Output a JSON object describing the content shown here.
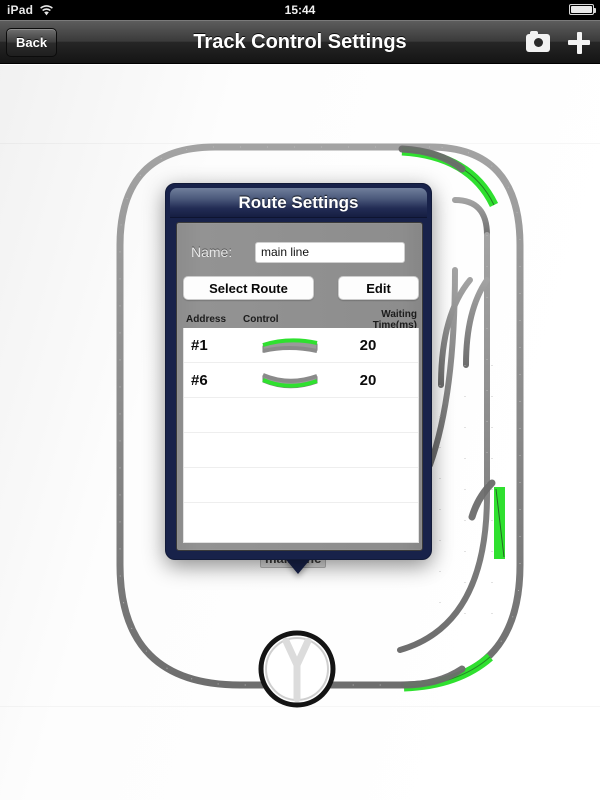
{
  "status_bar": {
    "carrier": "iPad",
    "wifi_icon": "wifi-icon",
    "clock": "15:44",
    "battery_icon": "battery-full-icon"
  },
  "nav_bar": {
    "back_label": "Back",
    "title": "Track Control Settings",
    "camera_icon": "camera-icon",
    "add_icon": "plus-icon"
  },
  "track_layout": {
    "label": "main line",
    "turntable_icon": "turntable-icon",
    "colors": {
      "rail": "#8c8c8c",
      "rail_dark": "#6f6f6f",
      "active_route": "#2fe02f",
      "background": "#ffffff"
    }
  },
  "popover": {
    "title": "Route Settings",
    "name_label": "Name:",
    "name_value": "main line",
    "name_placeholder": "Name",
    "select_route_label": "Select Route",
    "edit_label": "Edit",
    "table": {
      "columns": [
        "Address",
        "Control",
        "Waiting Time(ms)"
      ],
      "rows": [
        {
          "address": "#1",
          "control_icon": "turnout-diverging-icon",
          "control_state": "top",
          "waiting_time": "20"
        },
        {
          "address": "#6",
          "control_icon": "turnout-straight-icon",
          "control_state": "bottom",
          "waiting_time": "20"
        },
        {
          "address": "",
          "control_icon": "",
          "control_state": "",
          "waiting_time": ""
        },
        {
          "address": "",
          "control_icon": "",
          "control_state": "",
          "waiting_time": ""
        },
        {
          "address": "",
          "control_icon": "",
          "control_state": "",
          "waiting_time": ""
        },
        {
          "address": "",
          "control_icon": "",
          "control_state": "",
          "waiting_time": ""
        }
      ]
    }
  }
}
